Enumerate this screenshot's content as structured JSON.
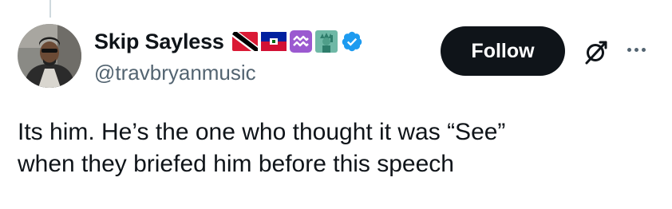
{
  "tweet": {
    "author": {
      "display_name": "Skip Sayless",
      "handle": "@travbryanmusic",
      "name_emojis": [
        "flag-trinidad-and-tobago-icon",
        "flag-haiti-icon",
        "aquarius-icon",
        "statue-of-liberty-icon"
      ],
      "verified": true
    },
    "follow_label": "Follow",
    "text_lines": [
      "Its him. He’s the one who thought it was “See”",
      "when they briefed him before this speech"
    ]
  },
  "colors": {
    "text_primary": "#0f1419",
    "text_secondary": "#536471",
    "verified_blue": "#1d9bf0",
    "follow_bg": "#0f1419",
    "follow_text": "#ffffff"
  }
}
